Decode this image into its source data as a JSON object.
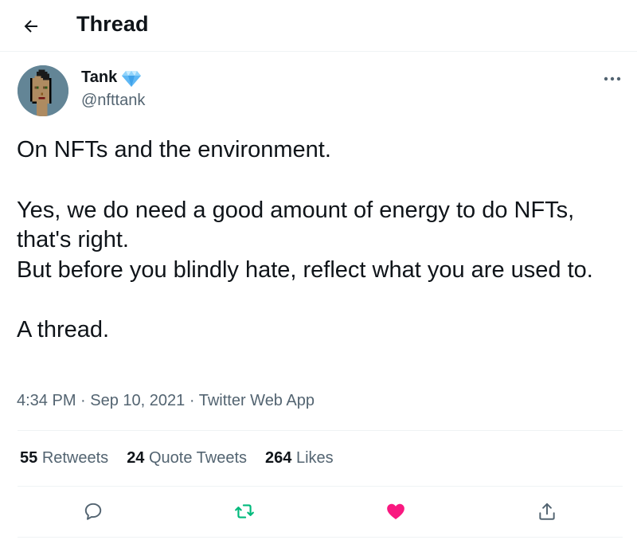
{
  "header": {
    "title": "Thread"
  },
  "author": {
    "name": "Tank",
    "handle": "@nfttank"
  },
  "tweet": {
    "lines": [
      "On NFTs and the environment.",
      "Yes, we do need a good amount of energy to do NFTs, that's right.",
      "But before you blindly hate, reflect what you are used to.",
      "A thread."
    ]
  },
  "meta": {
    "time": "4:34 PM",
    "separator": "·",
    "date": "Sep 10, 2021",
    "source": "Twitter Web App"
  },
  "stats": {
    "retweets_count": "55",
    "retweets_label": "Retweets",
    "quotes_count": "24",
    "quotes_label": "Quote Tweets",
    "likes_count": "264",
    "likes_label": "Likes"
  },
  "colors": {
    "text": "#0f1419",
    "secondary": "#536471",
    "retweet": "#00ba7c",
    "like": "#f91880",
    "verified_gem": "#5fb8f5"
  },
  "icons": [
    "arrow-left-icon",
    "verified-gem-icon",
    "more-dots-icon",
    "reply-icon",
    "retweet-icon",
    "like-heart-icon",
    "share-icon"
  ]
}
